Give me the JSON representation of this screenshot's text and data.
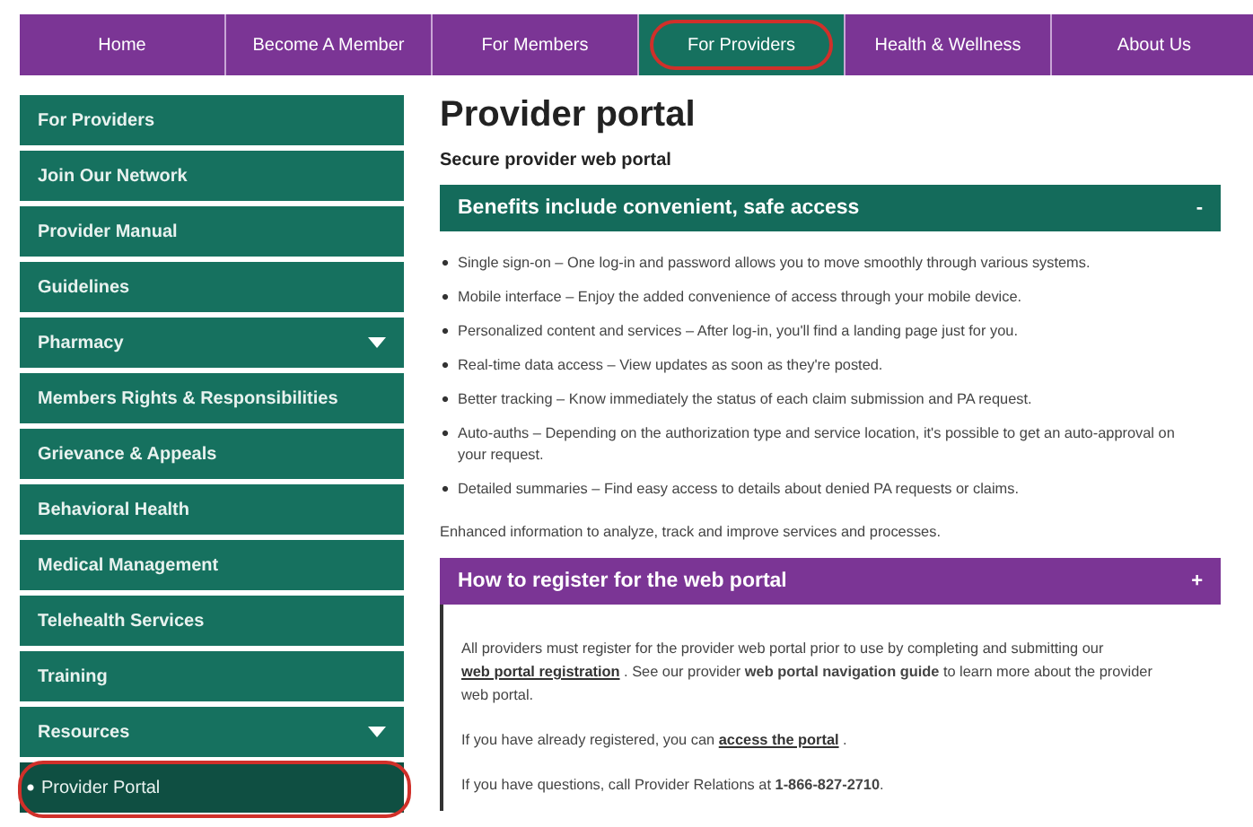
{
  "nav": [
    {
      "label": "Home",
      "selected": false,
      "circled": false
    },
    {
      "label": "Become A Member",
      "selected": false,
      "circled": false
    },
    {
      "label": "For Members",
      "selected": false,
      "circled": false
    },
    {
      "label": "For Providers",
      "selected": true,
      "circled": true
    },
    {
      "label": "Health & Wellness",
      "selected": false,
      "circled": false
    },
    {
      "label": "About Us",
      "selected": false,
      "circled": false
    }
  ],
  "sidebar": {
    "items": [
      {
        "label": "For Providers",
        "kind": "item",
        "has_submenu": false,
        "circled": false
      },
      {
        "label": "Join Our Network",
        "kind": "item",
        "has_submenu": false,
        "circled": false
      },
      {
        "label": "Provider Manual",
        "kind": "item",
        "has_submenu": false,
        "circled": false
      },
      {
        "label": "Guidelines",
        "kind": "item",
        "has_submenu": false,
        "circled": false
      },
      {
        "label": "Pharmacy",
        "kind": "item",
        "has_submenu": true,
        "circled": false
      },
      {
        "label": "Members Rights & Responsibilities",
        "kind": "item",
        "has_submenu": false,
        "circled": false
      },
      {
        "label": "Grievance & Appeals",
        "kind": "item",
        "has_submenu": false,
        "circled": false
      },
      {
        "label": "Behavioral Health",
        "kind": "item",
        "has_submenu": false,
        "circled": false
      },
      {
        "label": "Medical Management",
        "kind": "item",
        "has_submenu": false,
        "circled": false
      },
      {
        "label": "Telehealth Services",
        "kind": "item",
        "has_submenu": false,
        "circled": false
      },
      {
        "label": "Training",
        "kind": "item",
        "has_submenu": false,
        "circled": false
      },
      {
        "label": "Resources",
        "kind": "item",
        "has_submenu": true,
        "circled": false
      },
      {
        "label": "Provider Portal",
        "kind": "subitem",
        "has_submenu": false,
        "circled": true
      }
    ]
  },
  "page": {
    "title": "Provider portal",
    "subtitle": "Secure provider web portal",
    "sections": [
      {
        "title": "Benefits include convenient, safe access",
        "sign": "-",
        "expanded": true,
        "color": "#146b5b",
        "bullets": [
          "Single sign-on – One log-in and password allows you to move smoothly through various systems.",
          "Mobile interface – Enjoy the added convenience of access through your mobile device.",
          "Personalized content and services – After log-in, you'll find a landing page just for you.",
          "Real-time data access – View updates as soon as they're posted.",
          "Better tracking – Know immediately the status of each claim submission and PA request.",
          "Auto-auths – Depending on the authorization type and service location, it's possible to get an auto-approval on your request.",
          "Detailed summaries – Find easy access to details about denied PA requests or claims."
        ],
        "paragraphs": [
          [
            {
              "kind": "plain",
              "text": "Enhanced information to analyze, track and improve services and processes."
            }
          ]
        ]
      },
      {
        "title": "How to register for the web portal",
        "sign": "+",
        "expanded": true,
        "color": "#7b3595",
        "paragraphs": [
          [
            {
              "kind": "plain",
              "text": "All providers must register for the provider web portal prior to use by completing and submitting our "
            },
            {
              "kind": "link",
              "text": "web portal registration"
            },
            {
              "kind": "plain",
              "text": " . See our provider "
            },
            {
              "kind": "bold",
              "text": "web portal navigation guide"
            },
            {
              "kind": "plain",
              "text": " to learn more about the provider web portal."
            }
          ],
          [
            {
              "kind": "plain",
              "text": "If you have already registered, you can "
            },
            {
              "kind": "link",
              "text": "access the portal"
            },
            {
              "kind": "plain",
              "text": " ."
            }
          ],
          [
            {
              "kind": "plain",
              "text": "If you have questions, call Provider Relations at "
            },
            {
              "kind": "bold",
              "text": "1-866-827-2710"
            },
            {
              "kind": "plain",
              "text": "."
            }
          ]
        ]
      }
    ]
  }
}
